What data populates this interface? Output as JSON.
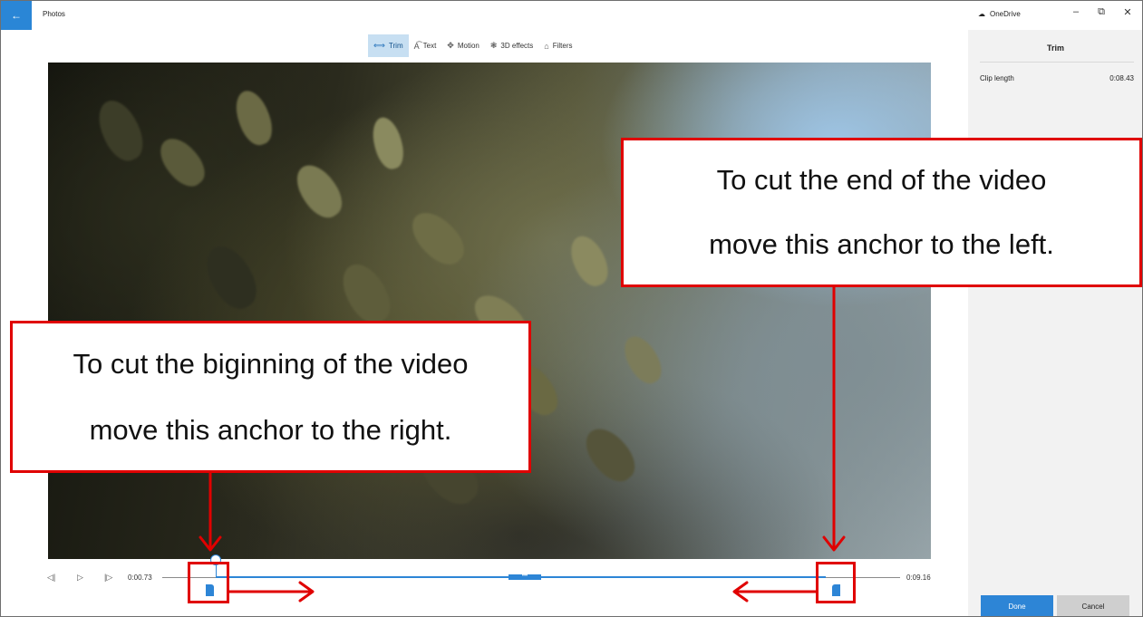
{
  "window": {
    "title": "Photos",
    "back_icon": "back-arrow-icon",
    "onedrive_label": "OneDrive",
    "minimize_glyph": "–",
    "restore_glyph": "⧉",
    "close_glyph": "✕"
  },
  "toolbar": {
    "items": [
      {
        "label": "Trim",
        "icon": "trim-icon",
        "glyph": "⟺",
        "active": true
      },
      {
        "label": "Text",
        "icon": "text-icon",
        "glyph": "A͡"
      },
      {
        "label": "Motion",
        "icon": "motion-icon",
        "glyph": "✥"
      },
      {
        "label": "3D effects",
        "icon": "3d-effects-icon",
        "glyph": "❃"
      },
      {
        "label": "Filters",
        "icon": "filters-icon",
        "glyph": "⌂"
      }
    ]
  },
  "panel": {
    "title": "Trim",
    "clip_length_label": "Clip length",
    "clip_length_value": "0:08.43",
    "done_label": "Done",
    "cancel_label": "Cancel"
  },
  "timeline": {
    "start_time": "0:00.73",
    "end_time": "0:09.16",
    "prev_frame_glyph": "◁|",
    "play_glyph": "▷",
    "next_frame_glyph": "|▷",
    "mid_handle_glyph": "•••"
  },
  "annotations": {
    "left_callout": {
      "line1": "To cut the biginning of the video",
      "line2": "move this anchor to the right."
    },
    "right_callout": {
      "line1": "To cut the end of the video",
      "line2": "move this anchor to the left."
    }
  },
  "colors": {
    "accent": "#2d85d6",
    "annotation_red": "#e00000",
    "panel_bg": "#f2f2f2"
  }
}
